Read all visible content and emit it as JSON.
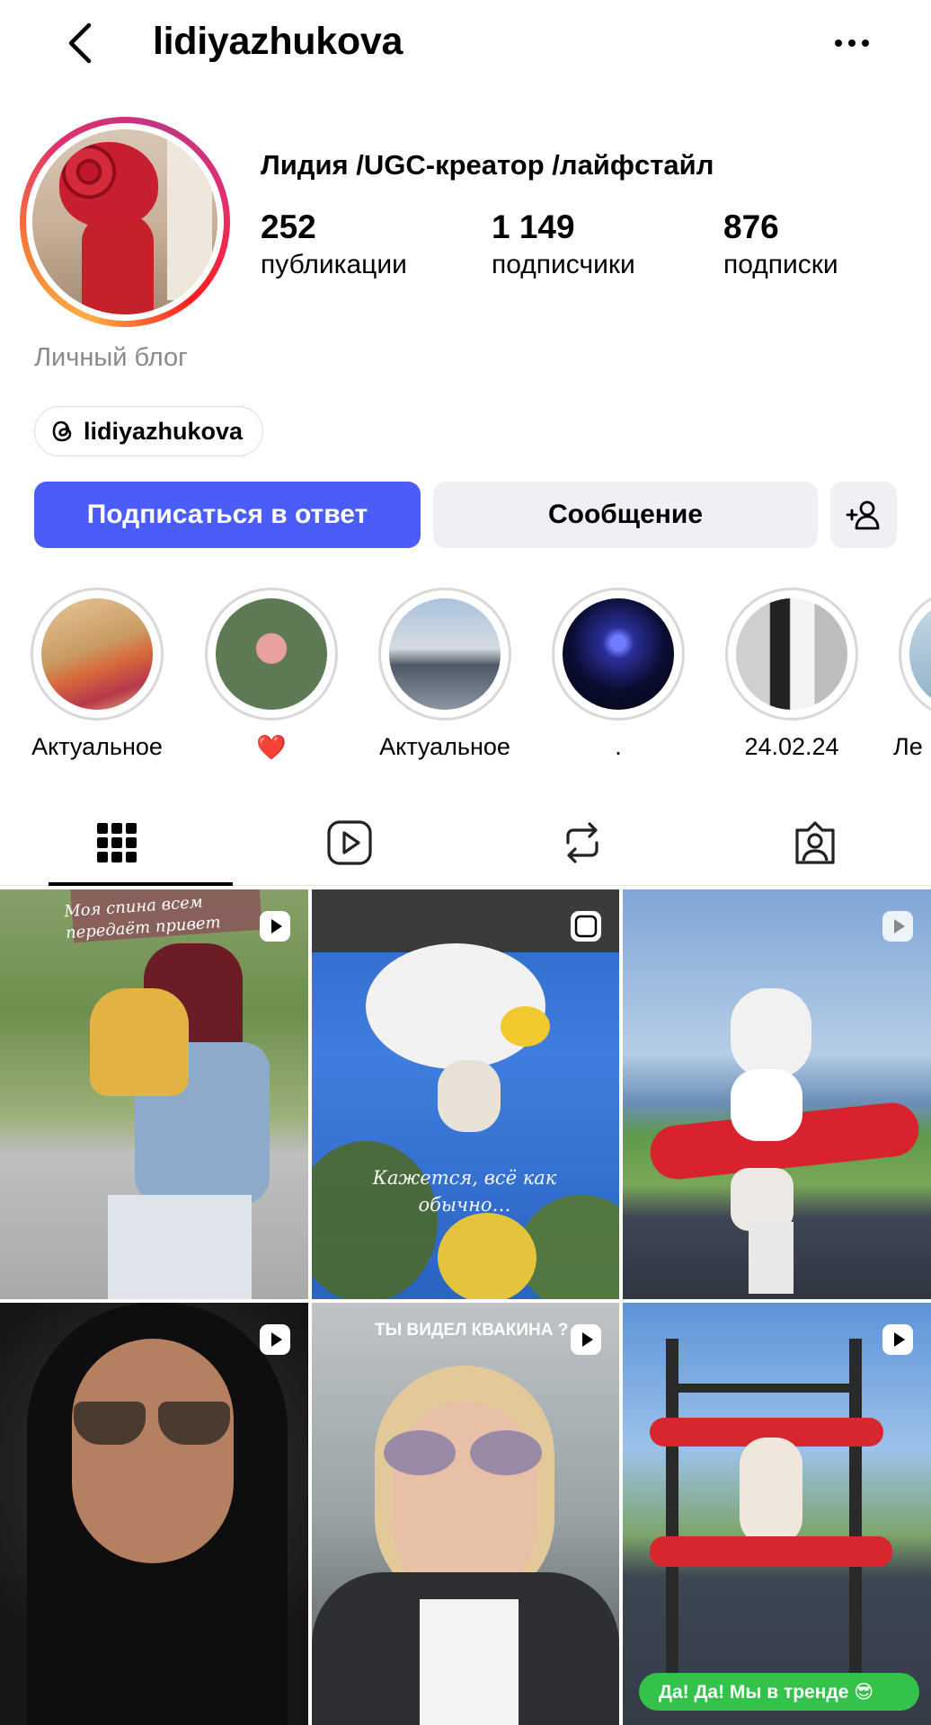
{
  "header": {
    "username": "lidiyazhukova"
  },
  "profile": {
    "display_name": "Лидия /UGC-креатор /лайфстайл",
    "stats": [
      {
        "value": "252",
        "label": "публикации"
      },
      {
        "value": "1 149",
        "label": "подписчики"
      },
      {
        "value": "876",
        "label": "подписки"
      }
    ],
    "category": "Личный блог",
    "threads_handle": "lidiyazhukova"
  },
  "actions": {
    "follow_back": "Подписаться в ответ",
    "message": "Сообщение"
  },
  "highlights": [
    {
      "label": "Актуальное"
    },
    {
      "label": "❤️"
    },
    {
      "label": "Актуальное"
    },
    {
      "label": "."
    },
    {
      "label": "24.02.24"
    },
    {
      "label": "Ле"
    }
  ],
  "posts": {
    "p1_caption": "Моя спина всем передаёт привет",
    "p2_caption": "Кажется, всё как обычно…",
    "p5_caption": "ТЫ ВИДЕЛ КВАКИНА ?",
    "p6_caption": "Да! Да! Мы в тренде 😎"
  },
  "colors": {
    "primary_button": "#4a5df9",
    "secondary_button": "#efeff4",
    "muted_text": "#8a8a8a",
    "highlight_ring": "#d8d8d8"
  },
  "icons": [
    "back-arrow-icon",
    "more-icon",
    "threads-icon",
    "add-person-icon",
    "grid-icon",
    "reels-icon",
    "reposts-icon",
    "tagged-icon",
    "reel-badge-icon"
  ]
}
